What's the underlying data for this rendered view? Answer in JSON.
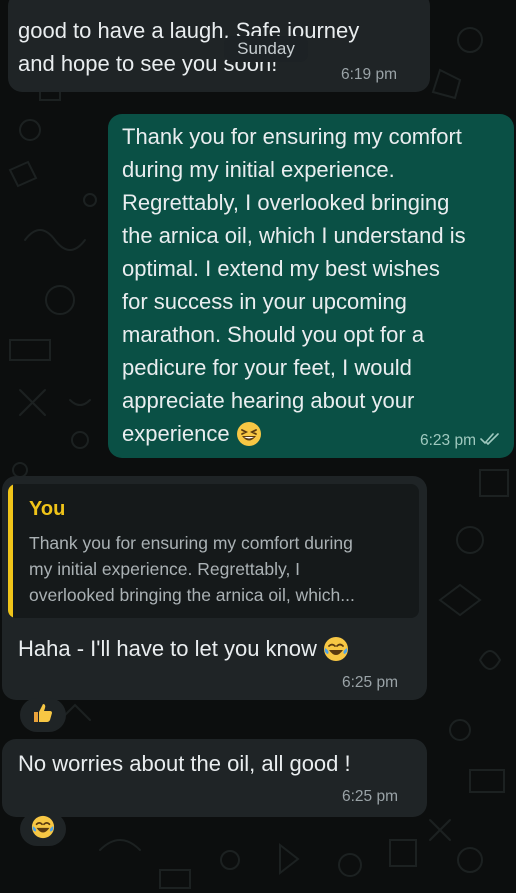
{
  "date_separator": "Sunday",
  "messages": [
    {
      "direction": "incoming",
      "text": "good to have a laugh. Safe journey\nand hope to see you soon!",
      "time": "6:19 pm"
    },
    {
      "direction": "outgoing",
      "text": "Thank you for ensuring my comfort\nduring my initial experience.\nRegrettably, I overlooked bringing\nthe arnica oil, which I understand is\noptimal. I extend my best wishes\nfor success in your upcoming\nmarathon. Should you opt for a\npedicure for your feet, I would\nappreciate hearing about your\nexperience",
      "emoji": "grinning-squinting-face",
      "time": "6:23 pm",
      "status": "read-ticks"
    },
    {
      "direction": "incoming",
      "quote": {
        "author": "You",
        "text": "Thank you for ensuring my comfort during\nmy initial experience. Regrettably, I\noverlooked bringing the arnica oil, which..."
      },
      "text": "Haha - I'll have to let you know",
      "emoji": "tears-of-joy-face",
      "time": "6:25 pm",
      "reaction": "thumbs-up"
    },
    {
      "direction": "incoming",
      "text": "No worries about the oil, all good !",
      "time": "6:25 pm",
      "reaction": "tears-of-joy-face"
    }
  ],
  "colors": {
    "background": "#0c0e0e",
    "incoming_bubble": "#1f2426",
    "outgoing_bubble": "#0a5045",
    "quote_accent": "#f0c419",
    "text": "#e9edef",
    "timestamp": "#9aa3a7"
  }
}
